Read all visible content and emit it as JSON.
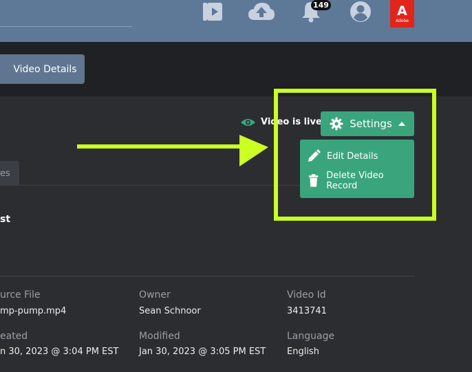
{
  "nav": {
    "notification_count": "149",
    "adobe_label": "Adobe",
    "adobe_letter": "A"
  },
  "header": {
    "video_details_button": "Video Details"
  },
  "tabs": {
    "partial_tab": "es"
  },
  "video": {
    "title_fragment": "st",
    "live_status": "Video is live"
  },
  "settings": {
    "button_label": "Settings",
    "menu_items": [
      {
        "label": "Edit Details",
        "icon": "pencil-icon"
      },
      {
        "label": "Delete Video Record",
        "icon": "trash-icon"
      }
    ]
  },
  "metadata": {
    "source_file": {
      "label": "urce File",
      "value": "mp-pump.mp4"
    },
    "owner": {
      "label": "Owner",
      "value": "Sean Schnoor"
    },
    "video_id": {
      "label": "Video Id",
      "value": "3413741"
    },
    "created": {
      "label": "eated",
      "value": "n 30, 2023 @ 3:04 PM EST"
    },
    "modified": {
      "label": "Modified",
      "value": "Jan 30, 2023 @ 3:05 PM EST"
    },
    "language": {
      "label": "Language",
      "value": "English"
    }
  },
  "colors": {
    "accent_green": "#3aa57d",
    "highlight_lime": "#ccff22",
    "nav_blue": "#5e7898",
    "adobe_red": "#e1251b"
  }
}
